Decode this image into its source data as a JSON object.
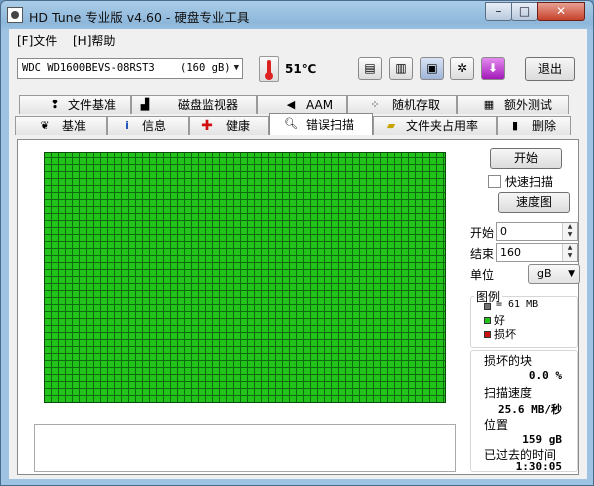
{
  "window": {
    "title": "HD Tune 专业版 v4.60 - 硬盘专业工具"
  },
  "caption_buttons": {
    "minimize": "–",
    "maximize": "□",
    "close": "✕"
  },
  "menu": {
    "file": "[F]文件",
    "help": "[H]帮助"
  },
  "toolbar": {
    "drive": "WDC WD1600BEVS-08RST3    (160 gB)",
    "temperature": "51℃",
    "exit": "退出",
    "icons": [
      "thermometer-icon",
      "copy-text-icon",
      "copy-screenshot-icon",
      "save-icon",
      "settings-icon",
      "download-icon"
    ]
  },
  "tabs_top": [
    "文件基准",
    "磁盘监视器",
    "AAM",
    "随机存取",
    "额外测试"
  ],
  "tabs_bottom": [
    "基准",
    "信息",
    "健康",
    "错误扫描",
    "文件夹占用率",
    "删除"
  ],
  "active_tab": "错误扫描",
  "controls": {
    "start": "开始",
    "quick_scan": "快速扫描",
    "quick_scan_checked": false,
    "speed_map": "速度图",
    "start_label": "开始",
    "start_value": "0",
    "end_label": "结束",
    "end_value": "160",
    "unit_label": "单位",
    "unit_value": "gB"
  },
  "legend": {
    "title": "图例",
    "block_size": "= 61 MB",
    "good": "好",
    "bad": "损坏",
    "colors": {
      "block": "#707070",
      "good": "#22c41c",
      "bad": "#cc1111"
    }
  },
  "stats": {
    "damaged_blocks_label": "损坏的块",
    "damaged_blocks_value": "0.0 %",
    "scan_speed_label": "扫描速度",
    "scan_speed_value": "25.6 MB/秒",
    "position_label": "位置",
    "position_value": "159 gB",
    "elapsed_label": "已过去的时间",
    "elapsed_value": "1:30:05"
  }
}
